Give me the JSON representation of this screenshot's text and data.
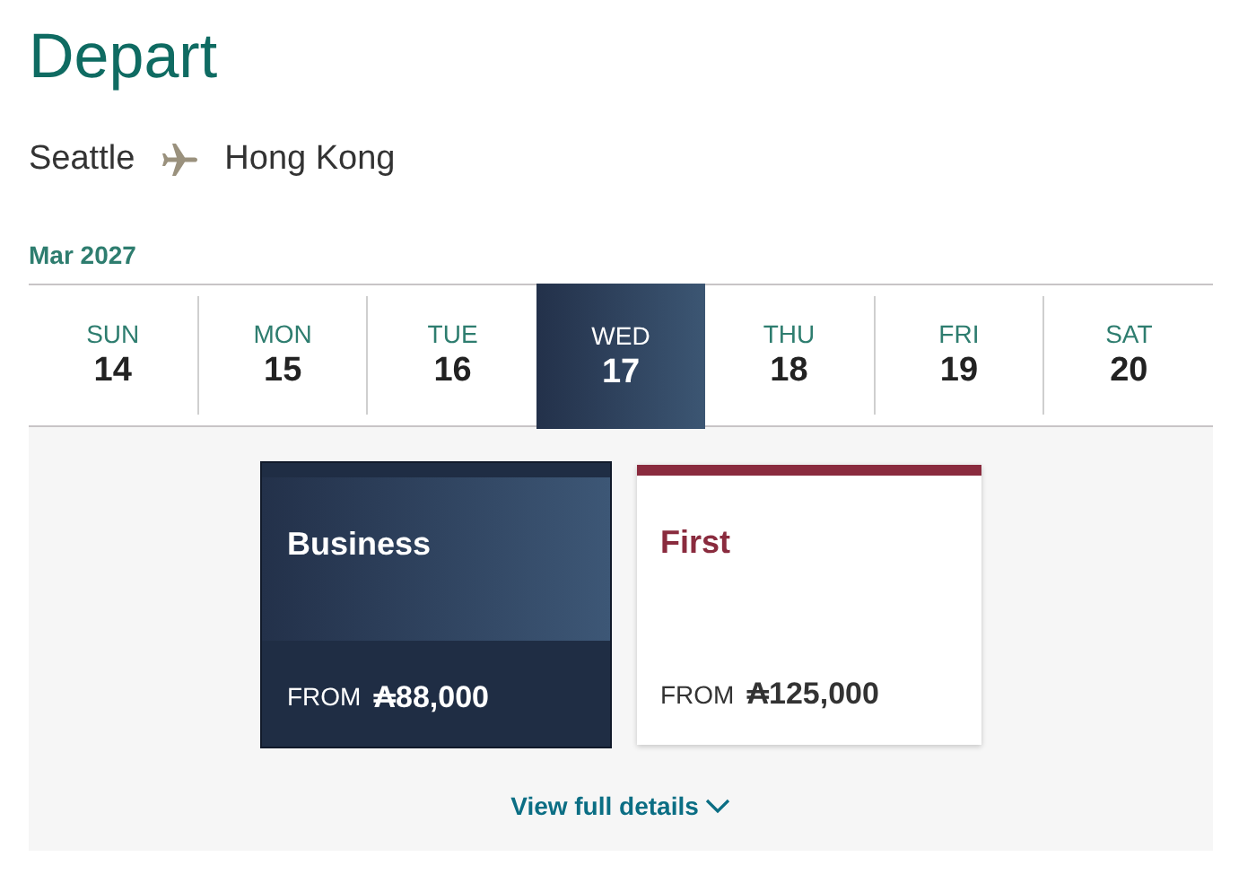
{
  "title": "Depart",
  "route": {
    "origin": "Seattle",
    "destination": "Hong Kong"
  },
  "month": "Mar 2027",
  "days": [
    {
      "weekday": "SUN",
      "date": "14",
      "selected": false
    },
    {
      "weekday": "MON",
      "date": "15",
      "selected": false
    },
    {
      "weekday": "TUE",
      "date": "16",
      "selected": false
    },
    {
      "weekday": "WED",
      "date": "17",
      "selected": true
    },
    {
      "weekday": "THU",
      "date": "18",
      "selected": false
    },
    {
      "weekday": "FRI",
      "date": "19",
      "selected": false
    },
    {
      "weekday": "SAT",
      "date": "20",
      "selected": false
    }
  ],
  "fares": [
    {
      "cabin": "Business",
      "from_label": "FROM",
      "price": "₳88,000",
      "selected": true
    },
    {
      "cabin": "First",
      "from_label": "FROM",
      "price": "₳125,000",
      "selected": false
    }
  ],
  "details_link": "View full details"
}
